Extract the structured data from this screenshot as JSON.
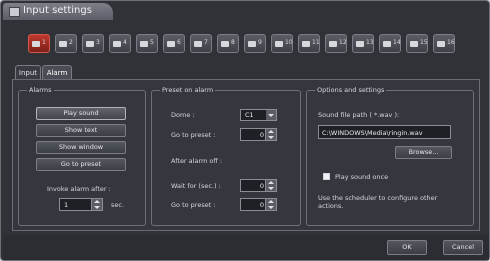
{
  "window": {
    "title": "Input settings"
  },
  "cameras": [
    {
      "num": "1",
      "active": true
    },
    {
      "num": "2"
    },
    {
      "num": "3"
    },
    {
      "num": "4"
    },
    {
      "num": "5"
    },
    {
      "num": "6"
    },
    {
      "num": "7"
    },
    {
      "num": "8"
    },
    {
      "num": "9"
    },
    {
      "num": "10"
    },
    {
      "num": "11"
    },
    {
      "num": "12"
    },
    {
      "num": "13"
    },
    {
      "num": "14"
    },
    {
      "num": "15"
    },
    {
      "num": "16"
    }
  ],
  "tabs": {
    "input": "Input",
    "alarm": "Alarm"
  },
  "alarms": {
    "group_label": "Alarms",
    "play_sound": "Play sound",
    "show_text": "Show text",
    "show_window": "Show window",
    "go_to_preset": "Go to preset",
    "invoke_label": "Invoke alarm after :",
    "invoke_value": "1",
    "invoke_unit": "sec."
  },
  "preset": {
    "group_label": "Preset on alarm",
    "dome_label": "Dome :",
    "dome_value": "C1",
    "goto_label": "Go to preset :",
    "goto_value": "0",
    "after_off_label": "After alarm off :",
    "wait_label": "Wait for (sec.) :",
    "wait_value": "0",
    "goto2_label": "Go to preset :",
    "goto2_value": "0"
  },
  "options": {
    "group_label": "Options and settings",
    "sound_path_label": "Sound file path ( *.wav ):",
    "sound_path_value": "C:\\WINDOWS\\Media\\ringin.wav",
    "browse": "Browse...",
    "play_once": "Play sound once",
    "note": "Use the scheduler to configure other actions."
  },
  "footer": {
    "ok": "OK",
    "cancel": "Cancel"
  }
}
